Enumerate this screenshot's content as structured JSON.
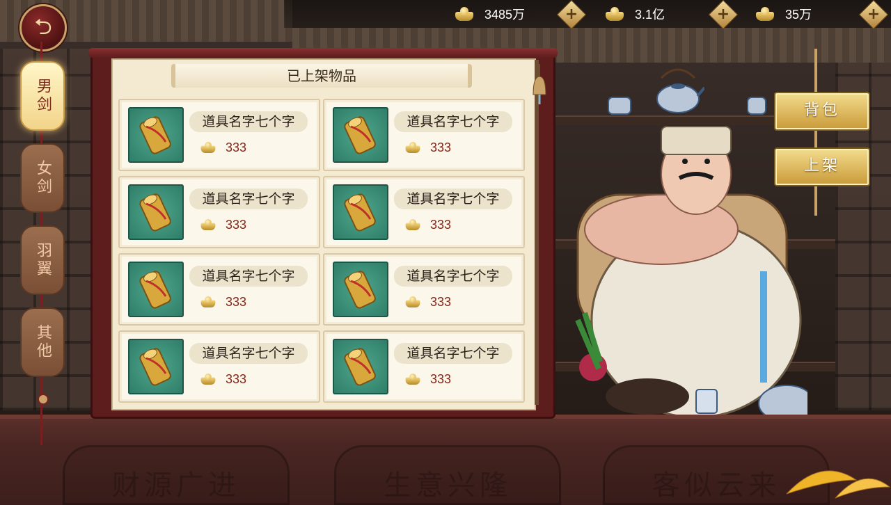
{
  "topbar": {
    "back_icon": "back-arrow-icon",
    "currencies": [
      {
        "icon": "gold-ingot-icon",
        "value": "3485万"
      },
      {
        "icon": "gold-ingot-icon",
        "value": "3.1亿"
      },
      {
        "icon": "gold-ingot-icon",
        "value": "35万"
      }
    ],
    "add_label": "+"
  },
  "tabs": [
    {
      "label": "男剑",
      "active": true
    },
    {
      "label": "女剑",
      "active": false
    },
    {
      "label": "羽翼",
      "active": false
    },
    {
      "label": "其他",
      "active": false
    }
  ],
  "panel": {
    "title": "已上架物品",
    "items": [
      {
        "name": "道具名字七个字",
        "price": "333",
        "icon": "scroll-item-icon"
      },
      {
        "name": "道具名字七个字",
        "price": "333",
        "icon": "scroll-item-icon"
      },
      {
        "name": "道具名字七个字",
        "price": "333",
        "icon": "scroll-item-icon"
      },
      {
        "name": "道具名字七个字",
        "price": "333",
        "icon": "scroll-item-icon"
      },
      {
        "name": "道具名字七个字",
        "price": "333",
        "icon": "scroll-item-icon"
      },
      {
        "name": "道具名字七个字",
        "price": "333",
        "icon": "scroll-item-icon"
      },
      {
        "name": "道具名字七个字",
        "price": "333",
        "icon": "scroll-item-icon"
      },
      {
        "name": "道具名字七个字",
        "price": "333",
        "icon": "scroll-item-icon"
      }
    ]
  },
  "actions": {
    "bag_label": "背包",
    "list_label": "上架"
  },
  "counter_engravings": [
    "财源广进",
    "生意兴隆",
    "客似云来"
  ],
  "colors": {
    "accent_gold": "#c99a38",
    "price_red": "#8a2418",
    "panel_red": "#5d1d1d",
    "item_bg": "#2f7d68"
  }
}
